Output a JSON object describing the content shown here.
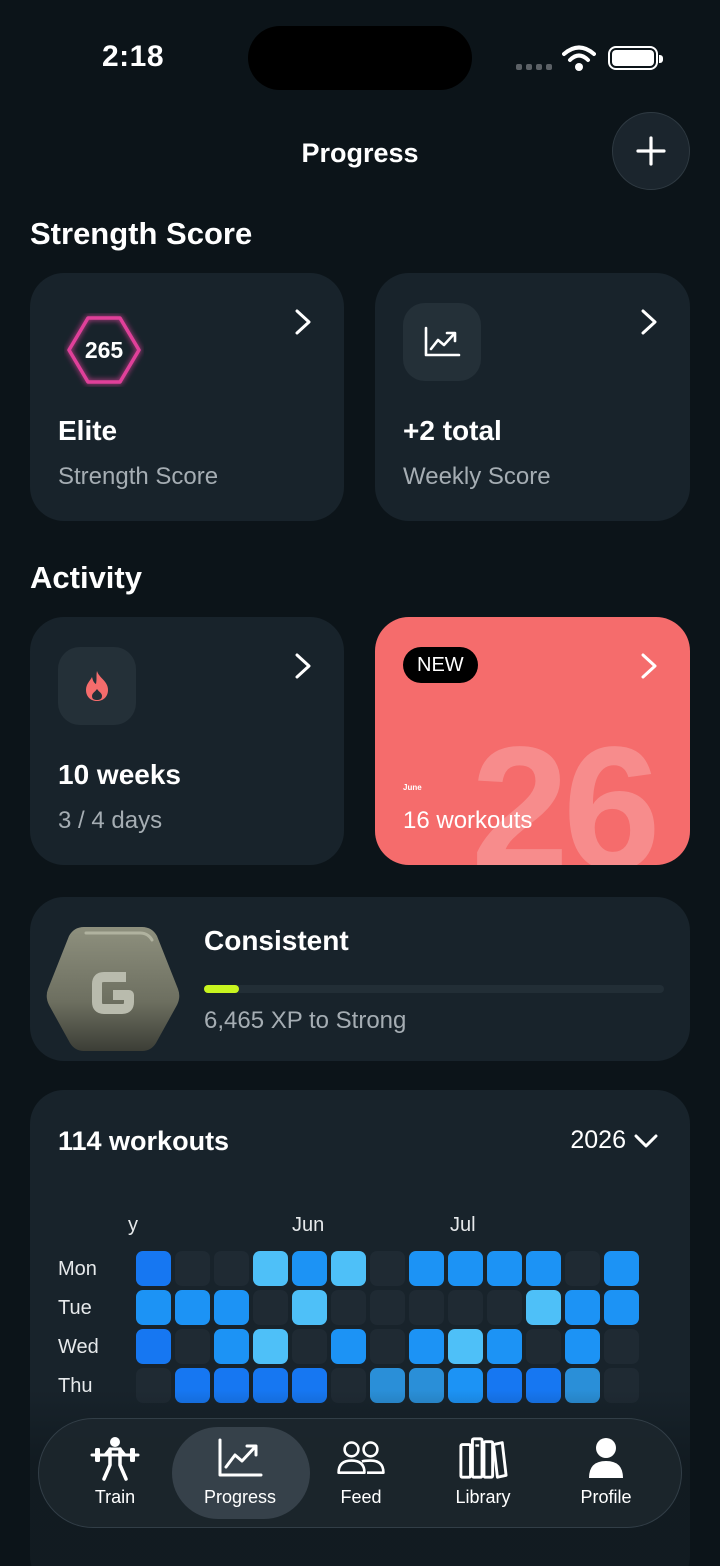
{
  "status_bar": {
    "time": "2:18"
  },
  "nav": {
    "title": "Progress"
  },
  "strength": {
    "section_title": "Strength Score",
    "score_card": {
      "score": "265",
      "title": "Elite",
      "subtitle": "Strength Score"
    },
    "weekly_card": {
      "icon": "trend-chart-icon",
      "title": "+2 total",
      "subtitle": "Weekly Score"
    }
  },
  "activity": {
    "section_title": "Activity",
    "streak_card": {
      "icon": "flame-icon",
      "title": "10 weeks",
      "subtitle": "3 / 4 days"
    },
    "month_card": {
      "badge": "NEW",
      "month": "June",
      "big_number": "26",
      "subtitle": "16 workouts",
      "color": "#f56c6c"
    }
  },
  "level": {
    "title": "Consistent",
    "subtitle": "6,465 XP to Strong",
    "progress": 0.075,
    "accent": "#c8f41f"
  },
  "heatmap": {
    "count": "114 workouts",
    "year": "2026",
    "months": [
      "y",
      "Jun",
      "Jul"
    ],
    "days": [
      "Mon",
      "Tue",
      "Wed",
      "Thu"
    ],
    "rows": [
      [
        1,
        0,
        0,
        3,
        2,
        3,
        0,
        2,
        2,
        2,
        2,
        0,
        2
      ],
      [
        2,
        2,
        2,
        0,
        3,
        0,
        0,
        0,
        0,
        0,
        3,
        2,
        2
      ],
      [
        1,
        0,
        2,
        3,
        0,
        2,
        0,
        2,
        3,
        2,
        0,
        2,
        0
      ],
      [
        0,
        1,
        1,
        1,
        1,
        0,
        4,
        4,
        2,
        1,
        1,
        4,
        0
      ]
    ]
  },
  "tabs": [
    {
      "label": "Train",
      "icon": "barbell-icon",
      "active": false
    },
    {
      "label": "Progress",
      "icon": "chart-icon",
      "active": true
    },
    {
      "label": "Feed",
      "icon": "people-icon",
      "active": false
    },
    {
      "label": "Library",
      "icon": "books-icon",
      "active": false
    },
    {
      "label": "Profile",
      "icon": "person-icon",
      "active": false
    }
  ]
}
